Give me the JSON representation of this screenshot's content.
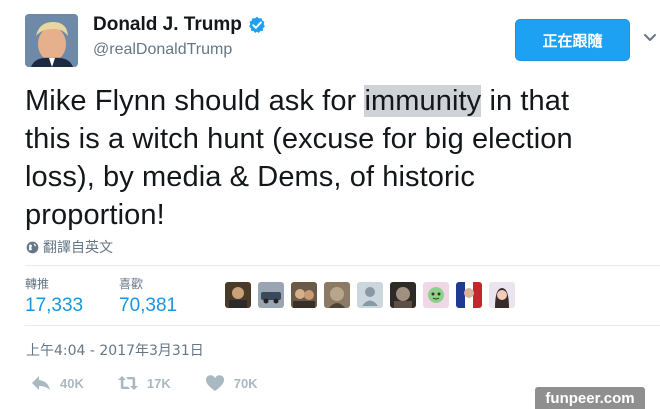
{
  "header": {
    "display_name": "Donald J. Trump",
    "handle": "@realDonaldTrump",
    "follow_label": "正在跟隨"
  },
  "tweet": {
    "line1_a": "Mike Flynn should ask for ",
    "line1_highlight": "immunity",
    "line1_b": " in that",
    "line2": "this is a witch hunt (excuse for big election",
    "line3": "loss), by media & Dems, of historic",
    "line4": "proportion!"
  },
  "translate_label": "翻譯自英文",
  "stats": {
    "retweets_label": "轉推",
    "retweets_value": "17,333",
    "likes_label": "喜歡",
    "likes_value": "70,381"
  },
  "timestamp": "上午4:04 - 2017年3月31日",
  "actions": {
    "reply_count": "40K",
    "retweet_count": "17K",
    "like_count": "70K"
  },
  "watermark": "funpeer.com",
  "colors": {
    "accent": "#1da1f2",
    "stat_value": "#1b95e0",
    "muted": "#657786",
    "action_icon": "#aab8c2"
  }
}
